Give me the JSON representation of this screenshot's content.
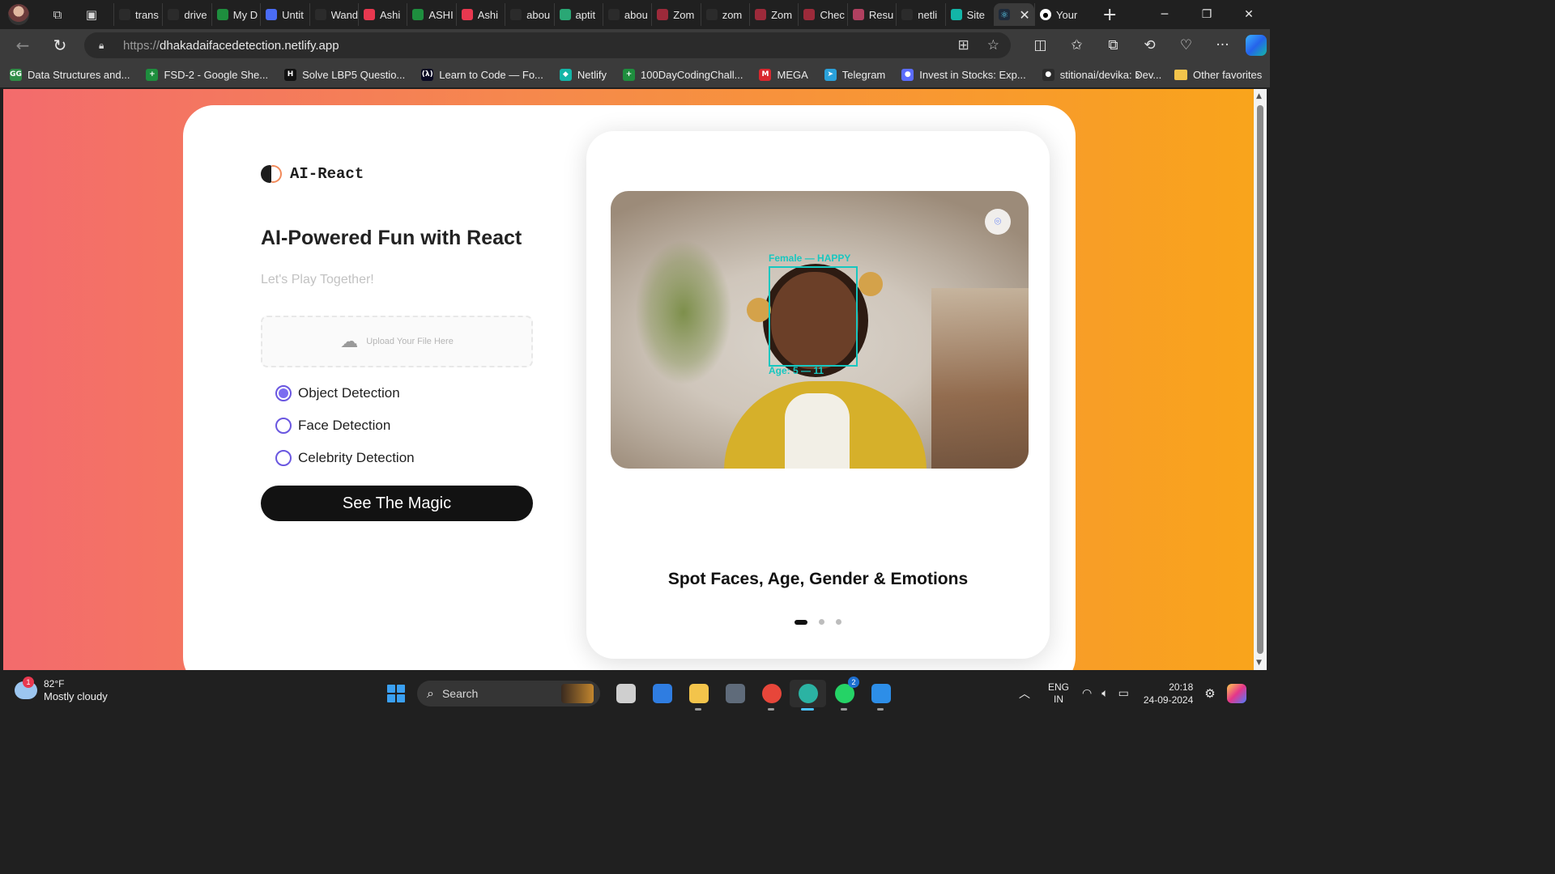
{
  "browser": {
    "tabs": [
      {
        "title": "trans",
        "icon": "search-icon",
        "color": "#2b2b2b"
      },
      {
        "title": "drive",
        "icon": "search-icon",
        "color": "#2b2b2b"
      },
      {
        "title": "My D",
        "icon": "google-drive-icon",
        "color": "#1e8e3e"
      },
      {
        "title": "Untit",
        "icon": "doc-icon",
        "color": "#4a6cf7"
      },
      {
        "title": "Wand",
        "icon": "page-icon",
        "color": "#2b2b2b"
      },
      {
        "title": "Ashi",
        "icon": "sr-icon",
        "color": "#e8384f"
      },
      {
        "title": "ASHI",
        "icon": "google-drive-icon",
        "color": "#1e8e3e"
      },
      {
        "title": "Ashi",
        "icon": "sr-icon",
        "color": "#e8384f"
      },
      {
        "title": "abou",
        "icon": "page-icon",
        "color": "#2b2b2b"
      },
      {
        "title": "aptit",
        "icon": "green-app-icon",
        "color": "#2aa775"
      },
      {
        "title": "abou",
        "icon": "page-icon",
        "color": "#2b2b2b"
      },
      {
        "title": "Zom",
        "icon": "zomato-icon",
        "color": "#9c2a3a"
      },
      {
        "title": "zom",
        "icon": "search-icon",
        "color": "#2b2b2b"
      },
      {
        "title": "Zom",
        "icon": "zomato-icon",
        "color": "#9c2a3a"
      },
      {
        "title": "Chec",
        "icon": "zomato-icon",
        "color": "#9c2a3a"
      },
      {
        "title": "Resu",
        "icon": "resume-icon",
        "color": "#b04060"
      },
      {
        "title": "netli",
        "icon": "search-icon",
        "color": "#2b2b2b"
      },
      {
        "title": "Site",
        "icon": "netlify-icon",
        "color": "#13b5a7"
      }
    ],
    "active_tab_icon": "react-icon",
    "github_tab": "Your",
    "url_prefix": "https://",
    "url_host": "dhakadaifacedetection.netlify.app",
    "favorites": [
      {
        "label": "Data Structures and...",
        "icon": "gfg-icon",
        "color": "#2f8d46",
        "glyph": "GG"
      },
      {
        "label": "FSD-2 - Google She...",
        "icon": "sheets-icon",
        "color": "#1e8e3e",
        "glyph": "+"
      },
      {
        "label": "Solve LBP5 Questio...",
        "icon": "hackerrank-icon",
        "color": "#111111",
        "glyph": "H"
      },
      {
        "label": "Learn to Code — Fo...",
        "icon": "freecodecamp-icon",
        "color": "#0a0a23",
        "glyph": "(λ)"
      },
      {
        "label": "Netlify",
        "icon": "netlify-icon",
        "color": "#13b5a7",
        "glyph": "◆"
      },
      {
        "label": "100DayCodingChall...",
        "icon": "sheets-icon",
        "color": "#1e8e3e",
        "glyph": "+"
      },
      {
        "label": "MEGA",
        "icon": "mega-icon",
        "color": "#d9272e",
        "glyph": "M"
      },
      {
        "label": "Telegram",
        "icon": "telegram-icon",
        "color": "#2aa1da",
        "glyph": "➤"
      },
      {
        "label": "Invest in Stocks: Exp...",
        "icon": "invest-icon",
        "color": "#5b6cff",
        "glyph": "●"
      },
      {
        "label": "stitionai/devika: Dev...",
        "icon": "github-icon",
        "color": "#2b2b2b",
        "glyph": "●"
      }
    ],
    "other_favorites": "Other favorites"
  },
  "app": {
    "brand": "AI-React",
    "headline": "AI-Powered Fun with React",
    "subline": "Let's Play Together!",
    "upload_text": "Upload Your File Here",
    "options": [
      {
        "label": "Object Detection",
        "selected": true
      },
      {
        "label": "Face Detection",
        "selected": false
      },
      {
        "label": "Celebrity Detection",
        "selected": false
      }
    ],
    "button": "See The Magic",
    "slide": {
      "box_label_top": "Female — HAPPY",
      "box_label_bottom": "Age: 5 — 11",
      "caption": "Spot Faces, Age, Gender & Emotions",
      "dots": 3,
      "active_dot": 0
    }
  },
  "taskbar": {
    "weather_temp": "82°F",
    "weather_desc": "Mostly cloudy",
    "weather_badge": "1",
    "search": "Search",
    "apps": [
      {
        "name": "task-view",
        "color": "#cfcfcf"
      },
      {
        "name": "microsoft-store",
        "color": "#2f7de1"
      },
      {
        "name": "file-explorer",
        "color": "#f3c44b"
      },
      {
        "name": "settings-app",
        "color": "#5f6b7a"
      },
      {
        "name": "chrome",
        "color": "#e7463a"
      },
      {
        "name": "edge",
        "color": "#2bb3a3"
      },
      {
        "name": "whatsapp",
        "color": "#25d366"
      },
      {
        "name": "vscode",
        "color": "#2d8ee8"
      }
    ],
    "whatsapp_badge": "2",
    "lang_top": "ENG",
    "lang_bottom": "IN",
    "time": "20:18",
    "date": "24-09-2024"
  }
}
